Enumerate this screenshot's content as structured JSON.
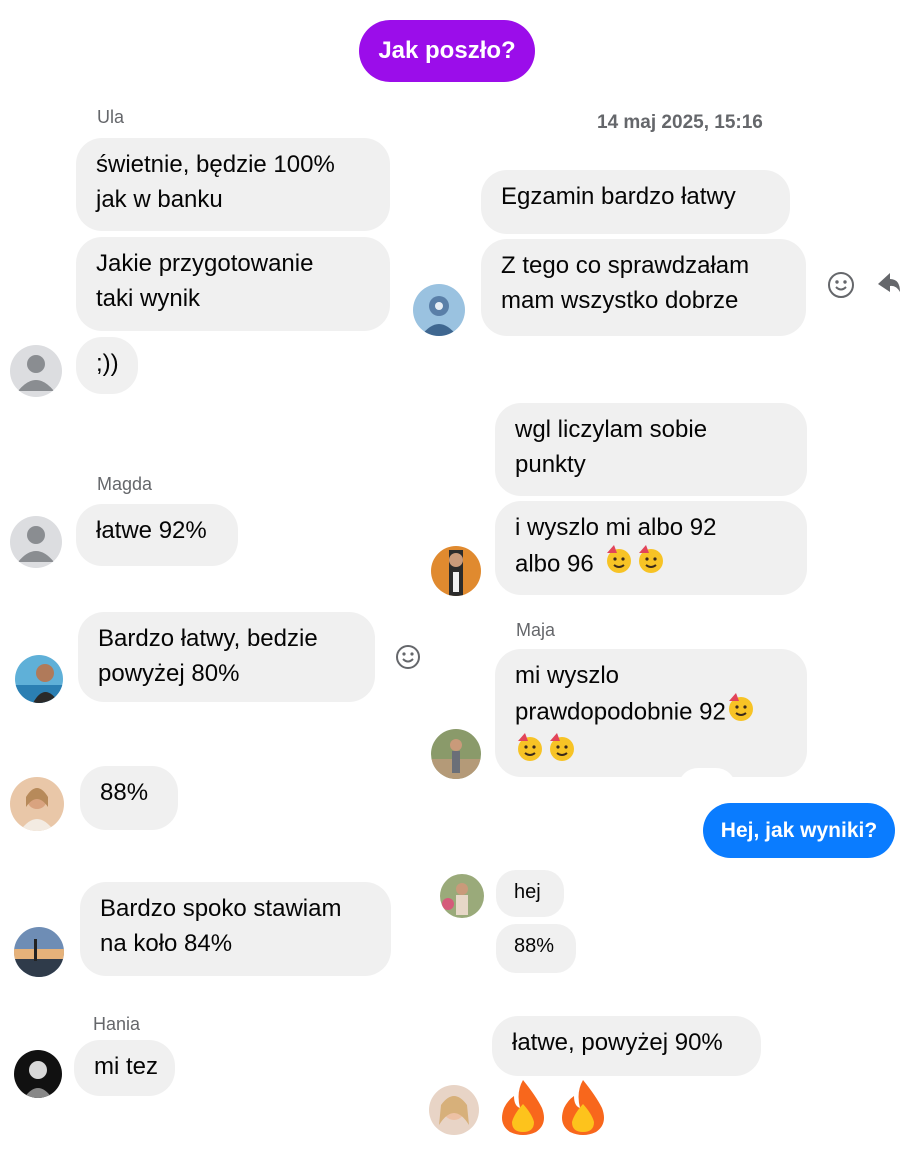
{
  "colors": {
    "purple": "#9b0dea",
    "blue": "#0a7cff",
    "bubble": "#f0f0f0",
    "meta": "#65676b"
  },
  "header": {
    "title": "Jak poszło?"
  },
  "timestamp": "14 maj 2025, 15:16",
  "left": {
    "ula": {
      "name": "Ula",
      "m1_l1": "świetnie, będzie 100%",
      "m1_l2": "jak w banku",
      "m2_l1": "Jakie przygotowanie",
      "m2_l2": "taki wynik",
      "m3": ";))"
    },
    "magda": {
      "name": "Magda",
      "m1": "łatwe 92%"
    },
    "u3": {
      "l1": "Bardzo łatwy, bedzie",
      "l2": "powyżej 80%"
    },
    "u4": {
      "m1": "88%"
    },
    "u5": {
      "l1": "Bardzo spoko stawiam",
      "l2": "na koło 84%"
    },
    "hania": {
      "name": "Hania",
      "m1": "mi tez"
    }
  },
  "right": {
    "r1": {
      "m1": "Egzamin bardzo łatwy",
      "m2_l1": "Z tego co sprawdzałam",
      "m2_l2": "mam wszystko dobrze"
    },
    "r2": {
      "m1_l1": "wgl liczylam sobie",
      "m1_l2": "punkty",
      "m2_l1": "i wyszlo mi albo 92",
      "m2_l2": "albo 96"
    },
    "maja": {
      "name": "Maja",
      "l1": "mi wyszlo",
      "l2": "prawdopodobnie 92"
    },
    "blue": {
      "text": "Hej, jak wyniki?"
    },
    "r4": {
      "m1": "hej",
      "m2": "88%"
    },
    "r5": {
      "m1": "łatwe, powyżej 90%"
    }
  },
  "icons": {
    "react": "smiley-face-icon",
    "forward": "forward-arrow-icon",
    "emoji_party": "partying-face-emoji",
    "emoji_fire": "fire-emoji"
  }
}
